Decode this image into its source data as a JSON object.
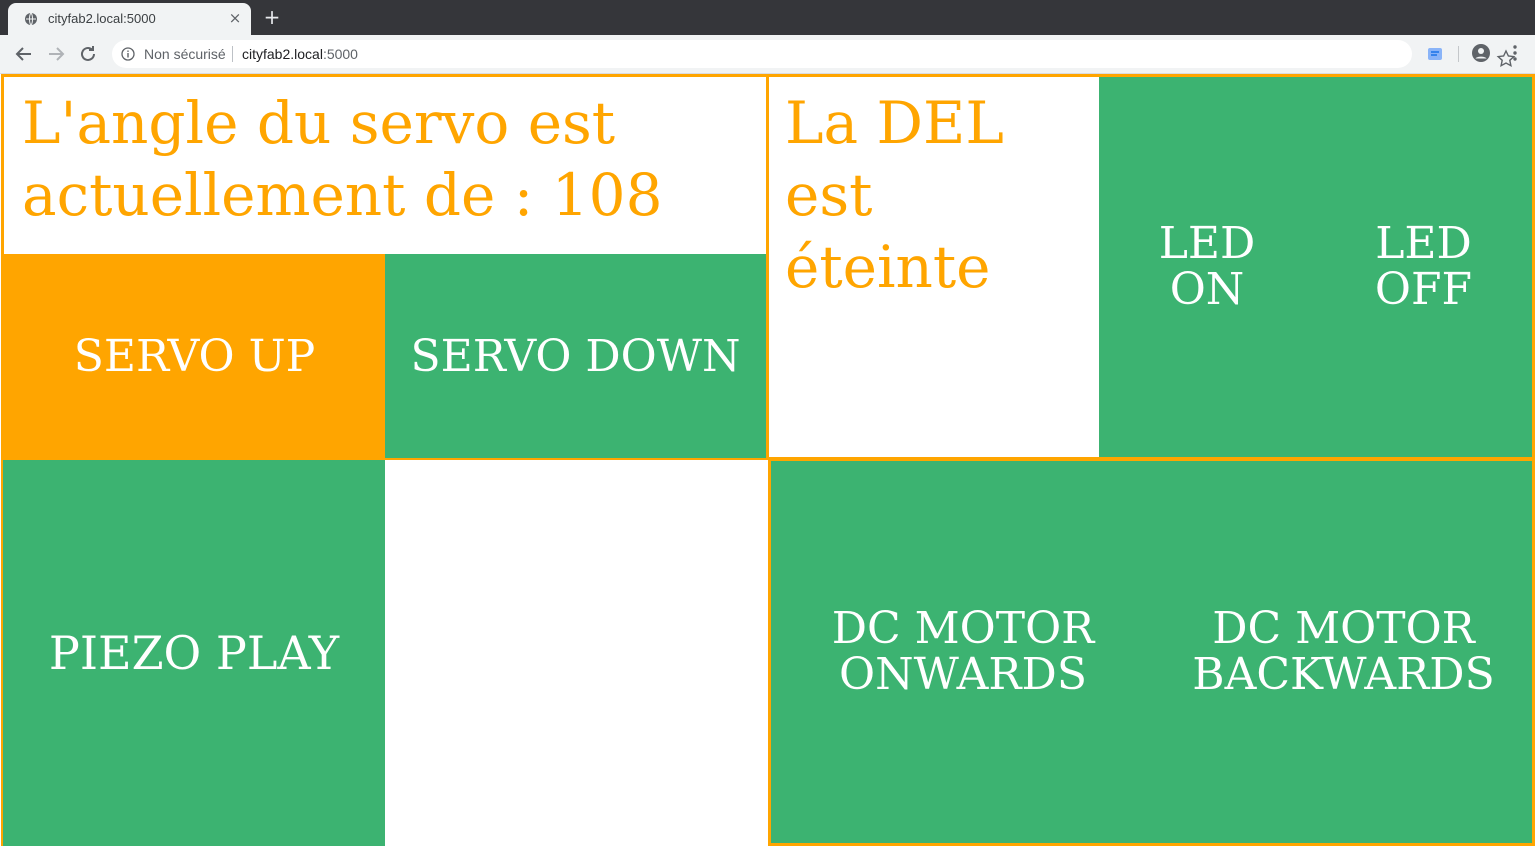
{
  "browser": {
    "tab_title": "cityfab2.local:5000",
    "tab_close": "×",
    "new_tab": "+",
    "security_label": "Non sécurisé",
    "url_host": "cityfab2.local",
    "url_port": ":5000"
  },
  "servo_panel": {
    "status_line1": "L'angle du servo est",
    "status_line2": "actuellement de : 108",
    "servo_up": "SERVO UP",
    "servo_down": "SERVO DOWN"
  },
  "led_panel": {
    "status_line1": "La DEL",
    "status_line2": "est",
    "status_line3": "éteinte",
    "led_on_line1": "LED",
    "led_on_line2": "ON",
    "led_off_line1": "LED",
    "led_off_line2": "OFF"
  },
  "piezo": {
    "play": "PIEZO PLAY"
  },
  "motor_panel": {
    "onwards_line1": "DC MOTOR",
    "onwards_line2": "ONWARDS",
    "backwards_line1": "DC MOTOR",
    "backwards_line2": "BACKWARDS"
  },
  "colors": {
    "accent_orange": "#ffa500",
    "button_green": "#3cb371",
    "chrome_dark": "#35363a",
    "chrome_light": "#f1f3f4"
  }
}
